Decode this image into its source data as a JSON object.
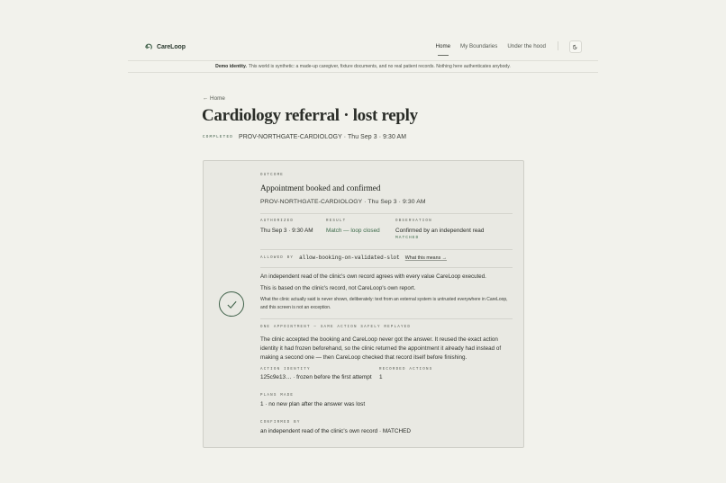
{
  "nav": {
    "brand": "CareLoop",
    "links": [
      {
        "label": "Home",
        "active": true
      },
      {
        "label": "My Boundaries",
        "active": false
      },
      {
        "label": "Under the hood",
        "active": false
      }
    ],
    "theme_icon": "moon-icon"
  },
  "banner": {
    "strong": "Demo identity.",
    "text": "This world is synthetic: a made-up caregiver, fixture documents, and no real patient records. Nothing here authenticates anybody."
  },
  "page": {
    "back_label": "← Home",
    "title": "Cardiology referral · lost reply",
    "status": "COMPLETED",
    "meta": "PROV-NORTHGATE-CARDIOLOGY · Thu Sep 3 · 9:30 AM"
  },
  "outcome": {
    "label": "OUTCOME",
    "title": "Appointment booked and confirmed",
    "meta": "PROV-NORTHGATE-CARDIOLOGY · Thu Sep 3 · 9:30 AM",
    "authorized_label": "AUTHORIZED",
    "authorized_value": "Thu Sep 3 · 9:30 AM",
    "result_label": "RESULT",
    "result_value": "Match — loop closed",
    "observation_label": "OBSERVATION",
    "observation_value": "Confirmed by an independent read",
    "observation_status": "MATCHED",
    "allowed_label": "ALLOWED BY",
    "allowed_code": "allow-booking-on-validated-slot",
    "allowed_link": "What this means →",
    "p1": "An independent read of the clinic's own record agrees with every value CareLoop executed.",
    "p2": "This is based on the clinic's record, not CareLoop's own report.",
    "p3": "What the clinic actually said is never shown, deliberately: text from an external system is untrusted everywhere in CareLoop, and this screen is not an exception."
  },
  "replay": {
    "label": "ONE APPOINTMENT — SAME ACTION SAFELY REPLAYED",
    "text": "The clinic accepted the booking and CareLoop never got the answer. It reused the exact action identity it had frozen beforehand, so the clinic returned the appointment it already had instead of making a second one — then CareLoop checked that record itself before finishing.",
    "action_identity_label": "ACTION IDENTITY",
    "action_identity_value": "125c9e13… · frozen before the first attempt",
    "recorded_actions_label": "RECORDED ACTIONS",
    "recorded_actions_value": "1",
    "plans_label": "PLANS MADE",
    "plans_value": "1 · no new plan after the answer was lost",
    "confirmed_label": "CONFIRMED BY",
    "confirmed_value": "an independent read of the clinic's own record · MATCHED"
  },
  "colors": {
    "background": "#f2f2ec",
    "card": "#e9e9e3",
    "accent_green": "#3d6a4a"
  }
}
